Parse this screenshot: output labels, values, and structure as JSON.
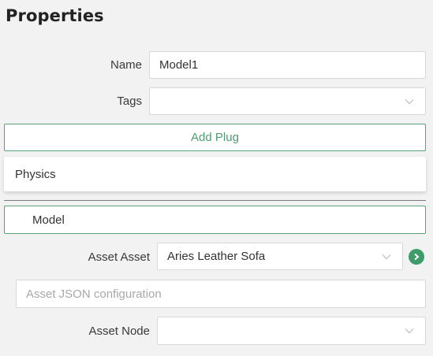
{
  "panel": {
    "title": "Properties"
  },
  "name": {
    "label": "Name",
    "value": "Model1"
  },
  "tags": {
    "label": "Tags",
    "value": ""
  },
  "add_plug": {
    "label": "Add Plug"
  },
  "plugs": {
    "physics_label": "Physics"
  },
  "model": {
    "header_label": "Model"
  },
  "asset": {
    "label": "Asset Asset",
    "value": "Aries Leather Sofa"
  },
  "asset_json": {
    "placeholder": "Asset JSON configuration",
    "value": ""
  },
  "asset_node": {
    "label": "Asset Node",
    "value": ""
  },
  "colors": {
    "accent": "#58a27a",
    "go": "#3e9c6a",
    "background": "#f2f2f2"
  },
  "icons": {
    "dropdown": "chevron-down-icon",
    "go": "chevron-right-circle-icon"
  }
}
